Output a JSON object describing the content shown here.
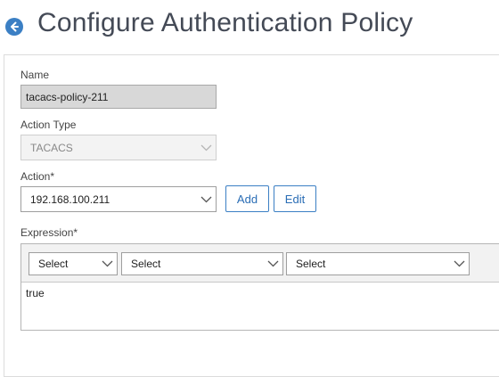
{
  "header": {
    "title": "Configure Authentication Policy",
    "back_icon": "back-arrow-icon",
    "accent_color": "#3b7fc4"
  },
  "form": {
    "name": {
      "label": "Name",
      "value": "tacacs-policy-211"
    },
    "action_type": {
      "label": "Action Type",
      "value": "TACACS"
    },
    "action": {
      "label": "Action*",
      "value": "192.168.100.211",
      "add_label": "Add",
      "edit_label": "Edit"
    },
    "expression": {
      "label": "Expression*",
      "selects": [
        "Select",
        "Select",
        "Select"
      ],
      "value": "true"
    }
  }
}
